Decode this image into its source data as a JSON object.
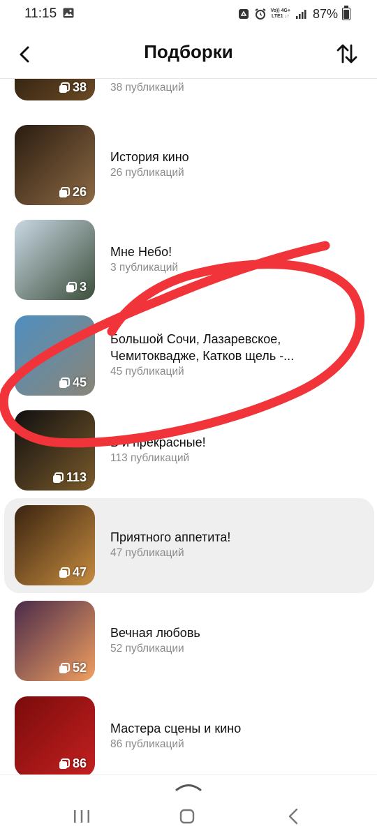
{
  "status_bar": {
    "time": "11:15",
    "network_top": "Vo)) 4G+",
    "network_bottom": "LTE1 ↓↑",
    "battery": "87%"
  },
  "header": {
    "title": "Подборки",
    "back_icon": "back-arrow-icon",
    "sort_icon": "sort-arrows-icon"
  },
  "collections": [
    {
      "name": "",
      "subtitle": "38 публикаций",
      "count": "38",
      "thumb_colors": [
        "#1a1209",
        "#6b4a25"
      ]
    },
    {
      "name": "История кино",
      "subtitle": "26 публикаций",
      "count": "26",
      "thumb_colors": [
        "#2a1c10",
        "#8d6a44"
      ]
    },
    {
      "name": "Мне Небо!",
      "subtitle": "3 публикаций",
      "count": "3",
      "thumb_colors": [
        "#c9d7e3",
        "#3c4f3c"
      ]
    },
    {
      "name": "Большой Сочи, Лазаревское, Чемитоквадже, Катков щель -...",
      "subtitle": "45 публикаций",
      "count": "45",
      "thumb_colors": [
        "#4f8fc0",
        "#8a8577"
      ]
    },
    {
      "name": "В и прекрасные!",
      "subtitle": "113 публикаций",
      "count": "113",
      "thumb_colors": [
        "#101010",
        "#7a5a2a"
      ]
    },
    {
      "name": "Приятного аппетита!",
      "subtitle": "47 публикаций",
      "count": "47",
      "thumb_colors": [
        "#3a2410",
        "#c78c3f"
      ]
    },
    {
      "name": "Вечная любовь",
      "subtitle": "52 публикации",
      "count": "52",
      "thumb_colors": [
        "#4a2a4a",
        "#f0a060"
      ]
    },
    {
      "name": "Мастера сцены и кино",
      "subtitle": "86 публикаций",
      "count": "86",
      "thumb_colors": [
        "#7a0b0b",
        "#c42020"
      ]
    }
  ],
  "highlighted_index": 5,
  "annotation": {
    "color": "#f1343a"
  }
}
